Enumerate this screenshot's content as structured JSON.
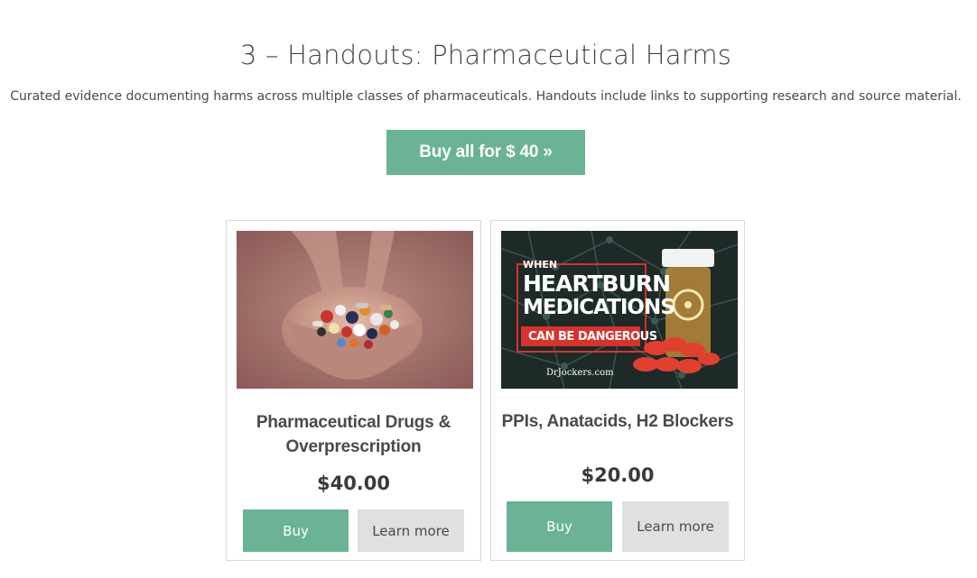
{
  "section": {
    "title": "3 – Handouts: Pharmaceutical Harms",
    "description": "Curated evidence documenting harms across multiple classes of pharmaceuticals. Handouts include links to supporting research and source material.",
    "buy_all_label": "Buy all for $ 40 »"
  },
  "products": [
    {
      "title_line1": "Pharmaceutical Drugs &",
      "title_line2": "Overprescription",
      "price": "$40.00",
      "buy_label": "Buy",
      "more_label": "Learn more",
      "image": "hands-holding-pills"
    },
    {
      "title_line1": "PPIs, Anatacids, H2 Blockers",
      "price": "$20.00",
      "buy_label": "Buy",
      "more_label": "Learn more",
      "image": "heartburn-medications-banner",
      "image_text": {
        "when": "WHEN",
        "line1": "HEARTBURN",
        "line2": "MEDICATIONS",
        "line3": "CAN BE DANGEROUS",
        "brand": "DrJockers.com"
      }
    }
  ],
  "colors": {
    "accent": "#6ab394",
    "secondary_button": "#e0e0e0",
    "banner_red": "#d8322c"
  }
}
